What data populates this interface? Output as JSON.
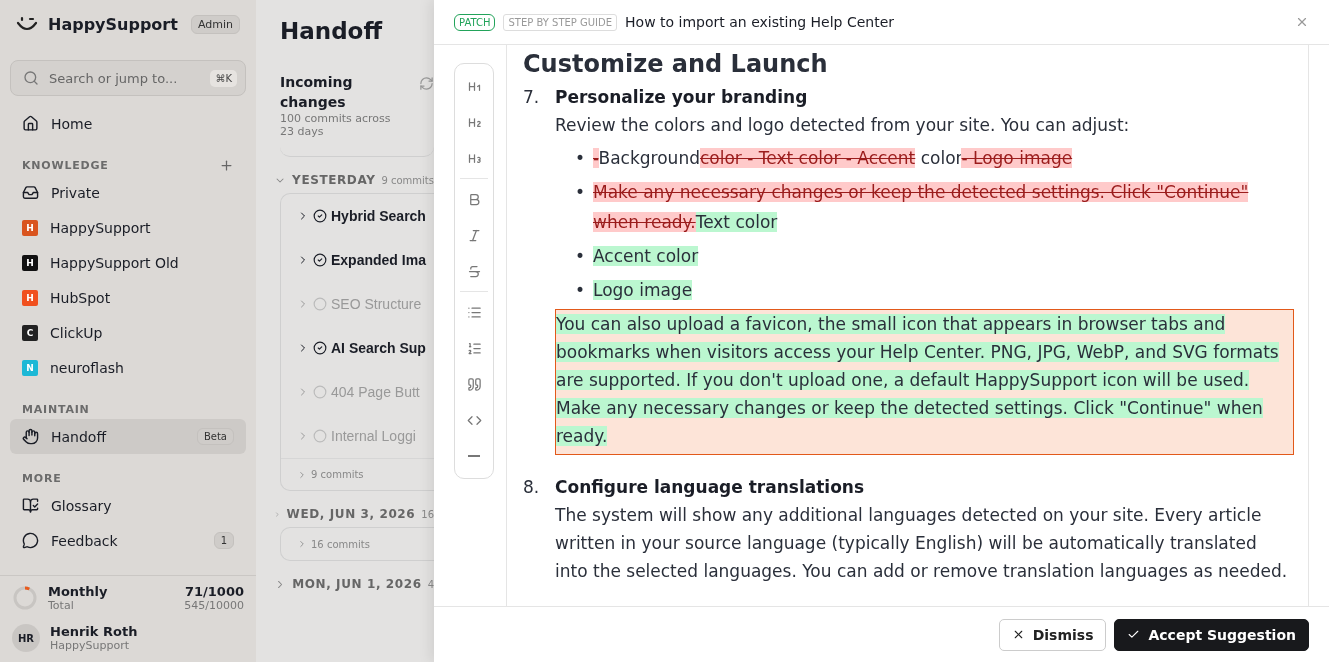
{
  "sidebar": {
    "brand": "HappySupport",
    "role_badge": "Admin",
    "search": {
      "placeholder": "Search or jump to...",
      "shortcut": "⌘K"
    },
    "home": {
      "label": "Home",
      "selected": false
    },
    "sections": [
      {
        "title": "KNOWLEDGE",
        "addable": true,
        "items": [
          {
            "label": "Private",
            "kind": "inbox",
            "selected": false
          },
          {
            "label": "HappySupport",
            "kind": "space",
            "letter": "H",
            "color": "#d9541e",
            "selected": false
          },
          {
            "label": "HappySupport Old",
            "kind": "space",
            "letter": "H",
            "color": "#111111",
            "selected": false
          },
          {
            "label": "HubSpot",
            "kind": "space",
            "letter": "H",
            "color": "#f0501e",
            "selected": false
          },
          {
            "label": "ClickUp",
            "kind": "space",
            "letter": "C",
            "color": "#222222",
            "selected": false
          },
          {
            "label": "neuroflash",
            "kind": "space",
            "letter": "N",
            "color": "#1cb8d6",
            "selected": false
          }
        ]
      },
      {
        "title": "MAINTAIN",
        "addable": false,
        "items": [
          {
            "label": "Handoff",
            "kind": "hand",
            "badge": "Beta",
            "selected": true
          }
        ]
      },
      {
        "title": "MORE",
        "addable": false,
        "items": [
          {
            "label": "Glossary",
            "kind": "book",
            "selected": false
          },
          {
            "label": "Feedback",
            "kind": "chat",
            "badge": "1",
            "selected": false
          }
        ]
      }
    ],
    "usage": {
      "label": "Monthly",
      "sublabel": "Total",
      "value": "71/1000",
      "total": "545/10000",
      "level": 0.071
    },
    "user": {
      "initials": "HR",
      "name": "Henrik Roth",
      "org": "HappySupport"
    }
  },
  "handoff": {
    "title": "Handoff",
    "incoming": {
      "title": "Incoming changes",
      "subtitle": "100 commits across 23 days"
    },
    "groups": [
      {
        "label": "YESTERDAY",
        "count": "9 commits",
        "expanded": true,
        "commits": [
          {
            "title": "Hybrid Search",
            "done": true
          },
          {
            "title": "Expanded Ima",
            "done": true
          },
          {
            "title": "SEO Structure",
            "done": false
          },
          {
            "title": "AI Search Sup",
            "done": true
          },
          {
            "title": "404 Page Butt",
            "done": false
          },
          {
            "title": "Internal Loggi",
            "done": false
          }
        ],
        "footer": "9 commits"
      },
      {
        "label": "WED, JUN 3, 2026",
        "count": "16",
        "expanded": false,
        "footer": "16 commits"
      },
      {
        "label": "MON, JUN 1, 2026",
        "count": "4",
        "expanded": false
      }
    ]
  },
  "drawer": {
    "tag": "PATCH",
    "category": "STEP BY STEP GUIDE",
    "title": "How to import an existing Help Center",
    "heading": "Customize and Launch",
    "steps": [
      {
        "number": "7.",
        "title": "Personalize your branding",
        "intro": "Review the colors and logo detected from your site. You can adjust:",
        "bullets": [
          {
            "marker": "•",
            "segments": [
              {
                "kind": "del",
                "text": "-"
              },
              {
                "kind": "plain",
                "text": "Background"
              },
              {
                "kind": "del",
                "text": "color - Text color - Accent"
              },
              {
                "kind": "plain",
                "text": " color"
              },
              {
                "kind": "del",
                "text": "- Logo image"
              }
            ]
          },
          {
            "marker": "•",
            "segments": [
              {
                "kind": "del",
                "text": "Make any necessary changes or keep the detected settings. Click \"Continue\" when ready."
              },
              {
                "kind": "ins",
                "text": "Text color"
              }
            ]
          },
          {
            "marker": "•",
            "segments": [
              {
                "kind": "ins",
                "text": "Accent color"
              }
            ]
          },
          {
            "marker": "•",
            "segments": [
              {
                "kind": "ins",
                "text": "Logo image"
              }
            ]
          }
        ],
        "paragraph": {
          "kind": "ins",
          "selected": true,
          "text": "You can also upload a favicon, the small icon that appears in browser tabs and bookmarks when visitors access your Help Center. PNG, JPG, WebP, and SVG formats are supported. If you don't upload one, a default HappySupport icon will be used. Make any necessary changes or keep the detected settings. Click \"Continue\" when ready."
        }
      },
      {
        "number": "8.",
        "title": "Configure language translations",
        "intro": "The system will show any additional languages detected on your site. Every article written in your source language (typically English) will be automatically translated into the selected languages. You can add or remove translation languages as needed."
      }
    ],
    "buttons": [
      {
        "kind": "secondary",
        "label": "Dismiss"
      },
      {
        "kind": "primary",
        "label": "Accept Suggestion"
      }
    ]
  }
}
